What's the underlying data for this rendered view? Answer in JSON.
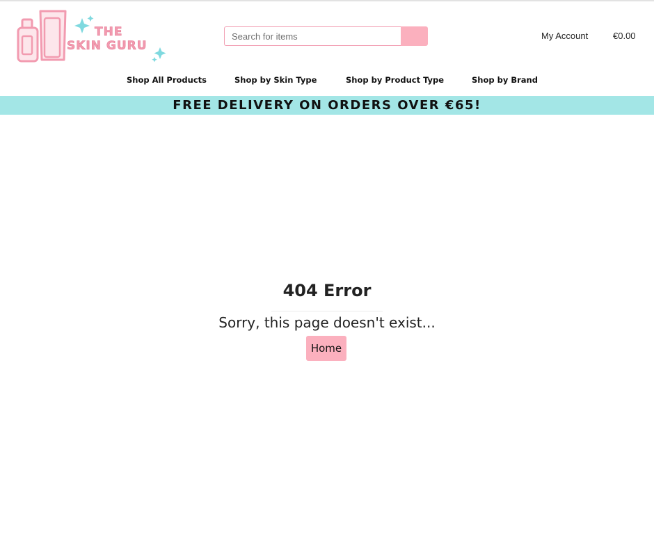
{
  "header": {
    "logo": {
      "line1": "THE",
      "line2": "SKIN GURU",
      "icon": "skincare-bottles-sparkle-logo"
    },
    "search": {
      "placeholder": "Search for items",
      "value": "",
      "button_icon": "search-icon"
    },
    "account_label": "My Account",
    "cart_total": "€0.00"
  },
  "nav": {
    "items": [
      {
        "label": "Shop All Products"
      },
      {
        "label": "Shop by Skin Type"
      },
      {
        "label": "Shop by Product Type"
      },
      {
        "label": "Shop by Brand"
      }
    ]
  },
  "banner": {
    "text": "FREE DELIVERY ON ORDERS OVER €65!"
  },
  "main": {
    "error_title": "404 Error",
    "error_message": "Sorry, this page doesn't exist...",
    "home_button": "Home"
  },
  "colors": {
    "brand_pink": "#fbb0be",
    "logo_pink": "#f29bb0",
    "banner_teal": "#a3e6e6",
    "sparkle_teal": "#7fd9df"
  }
}
